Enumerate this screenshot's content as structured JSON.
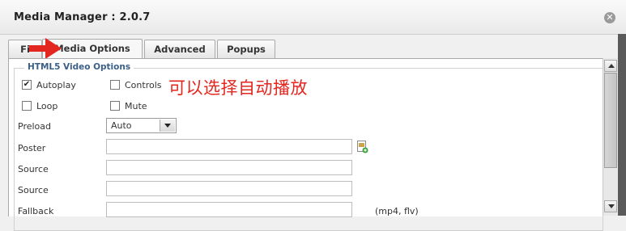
{
  "dialog": {
    "title": "Media Manager : 2.0.7",
    "close_icon": "close-icon"
  },
  "tabs": [
    {
      "label": "Fi",
      "state": "inactive"
    },
    {
      "label": "Media Options",
      "state": "active"
    },
    {
      "label": "Advanced",
      "state": "inactive"
    },
    {
      "label": "Popups",
      "state": "inactive"
    }
  ],
  "section": {
    "legend": "HTML5 Video Options"
  },
  "checkboxes": {
    "autoplay": {
      "label": "Autoplay",
      "checked": true,
      "mark": "✔"
    },
    "controls": {
      "label": "Controls",
      "checked": false
    },
    "loop": {
      "label": "Loop",
      "checked": false
    },
    "mute": {
      "label": "Mute",
      "checked": false
    }
  },
  "fields": {
    "preload": {
      "label": "Preload",
      "value": "Auto"
    },
    "poster": {
      "label": "Poster",
      "value": ""
    },
    "source1": {
      "label": "Source",
      "value": ""
    },
    "source2": {
      "label": "Source",
      "value": ""
    },
    "fallback": {
      "label": "Fallback",
      "hint": "(mp4, flv)"
    }
  },
  "annotation": {
    "text": "可以选择自动播放",
    "color": "#e3261f"
  },
  "colors": {
    "legend": "#3b5f86",
    "arrow": "#e3261f"
  }
}
